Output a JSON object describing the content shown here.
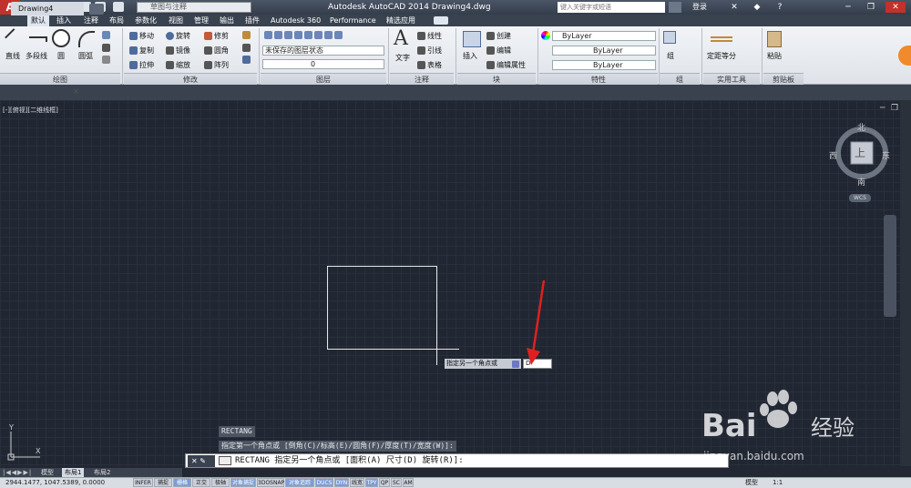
{
  "titlebar": {
    "workspace": "草图与注释",
    "app_title": "Autodesk AutoCAD 2014    Drawing4.dwg",
    "search_placeholder": "键入关键字或短语",
    "login": "登录"
  },
  "menu_tabs": [
    "默认",
    "插入",
    "注释",
    "布局",
    "参数化",
    "视图",
    "管理",
    "输出",
    "插件",
    "Autodesk 360",
    "Performance",
    "精选应用"
  ],
  "ribbon": {
    "draw": {
      "items": [
        "直线",
        "多段线",
        "圆",
        "圆弧"
      ],
      "label": "绘图"
    },
    "modify": {
      "items": [
        "移动",
        "旋转",
        "修剪",
        "复制",
        "镜像",
        "圆角",
        "拉伸",
        "缩放",
        "阵列"
      ],
      "label": "修改"
    },
    "layers": {
      "layer_state": "未保存的图层状态",
      "current_layer": "0",
      "label": "图层"
    },
    "annotation": {
      "items": [
        "文字",
        "线性",
        "引线",
        "表格"
      ],
      "label": "注释"
    },
    "block": {
      "items": [
        "插入",
        "创建",
        "编辑",
        "编辑属性"
      ],
      "label": "块"
    },
    "properties": {
      "color": "ByLayer",
      "linetype": "ByLayer",
      "lineweight": "ByLayer",
      "label": "特性"
    },
    "groups": {
      "items": [
        "组"
      ],
      "label": "组"
    },
    "utilities": {
      "items": [
        "定距等分"
      ],
      "label": "实用工具"
    },
    "clipboard": {
      "items": [
        "粘贴"
      ],
      "label": "剪贴板"
    }
  },
  "doc_tab": {
    "label": "Drawing4"
  },
  "viewport_label": "[-][俯视][二维线框]",
  "viewcube": {
    "north": "北",
    "south": "南",
    "east": "东",
    "west": "西",
    "center": "上",
    "wcs": "WCS"
  },
  "prompt": {
    "label": "指定另一个角点或",
    "input": "D"
  },
  "command_history": [
    "RECTANG",
    "指定第一个角点或 [倒角(C)/标高(E)/圆角(F)/厚度(T)/宽度(W)]:"
  ],
  "command_line": "RECTANG 指定另一个角点或 [面积(A) 尺寸(D) 旋转(R)]:",
  "layout_tabs": [
    "模型",
    "布局1",
    "布局2"
  ],
  "status": {
    "coords": "2944.1477, 1047.5389, 0.0000",
    "toggles": [
      "INFER",
      "捕捉",
      "栅格",
      "正交",
      "极轴",
      "对象捕捉",
      "3DOSNAP",
      "对象追踪",
      "DUCS",
      "DYN",
      "线宽",
      "TPY",
      "QP",
      "SC",
      "AM"
    ],
    "model": "模型",
    "scale": "1:1"
  },
  "watermark": {
    "brand": "Bai",
    "brand_cn": "经验",
    "url": "jingyan.baidu.com"
  }
}
